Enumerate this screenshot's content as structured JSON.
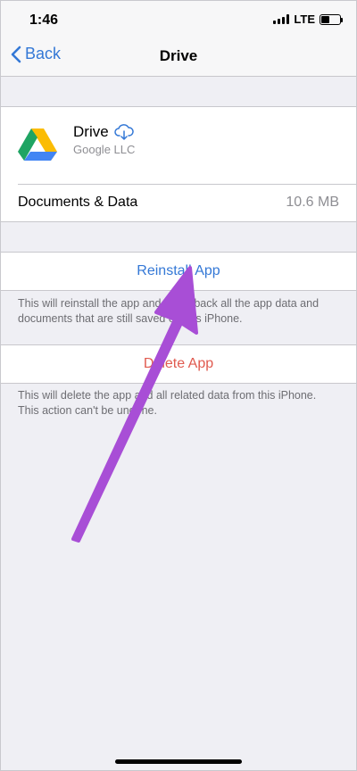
{
  "status_bar": {
    "time": "1:46",
    "network": "LTE",
    "icons": [
      "signal-bars-icon",
      "battery-icon"
    ]
  },
  "nav": {
    "back_label": "Back",
    "title": "Drive"
  },
  "app": {
    "name": "Drive",
    "developer": "Google LLC",
    "icon": "google-drive-icon",
    "cloud_icon": "cloud-download-icon",
    "documents_label": "Documents & Data",
    "documents_size": "10.6 MB"
  },
  "actions": {
    "reinstall_label": "Reinstall App",
    "reinstall_note": "This will reinstall the app and place back all the app data and documents that are still saved on this iPhone.",
    "delete_label": "Delete App",
    "delete_note": "This will delete the app and all related data from this iPhone. This action can't be undone."
  },
  "colors": {
    "accent": "#3478d6",
    "destructive": "#e05a4f",
    "annotation_arrow": "#a84ed6",
    "background": "#efeff4"
  }
}
